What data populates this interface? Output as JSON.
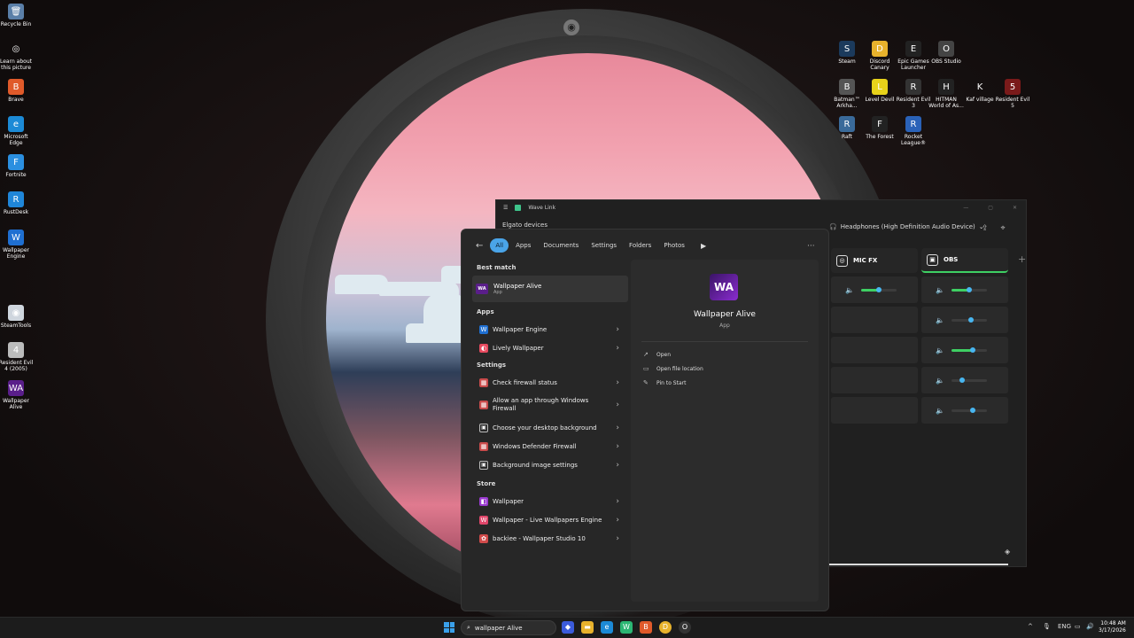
{
  "desktop_left": [
    {
      "label": "Recycle Bin",
      "icon": "recycle-bin-icon",
      "glyph": "🗑",
      "color": "#5a7fa8"
    },
    {
      "label": "Learn about this picture",
      "icon": "info-camera-icon",
      "glyph": "◎",
      "color": "transparent"
    },
    {
      "label": "Brave",
      "icon": "brave-icon",
      "glyph": "B",
      "color": "#e05a2a"
    },
    {
      "label": "Microsoft Edge",
      "icon": "edge-icon",
      "glyph": "e",
      "color": "#1c8ad6"
    },
    {
      "label": "Fortnite",
      "icon": "fortnite-icon",
      "glyph": "F",
      "color": "#2b8fe0"
    },
    {
      "label": "RustDesk",
      "icon": "rustdesk-icon",
      "glyph": "R",
      "color": "#1f86d9"
    },
    {
      "label": "Wallpaper Engine",
      "icon": "wallpaper-engine-icon",
      "glyph": "W",
      "color": "#1f6fd1"
    },
    {
      "label": "SteamTools",
      "icon": "steamtools-icon",
      "glyph": "◉",
      "color": "#cfd6de"
    },
    {
      "label": "Resident Evil 4 (2005)",
      "icon": "resident-evil-4-icon",
      "glyph": "4",
      "color": "#bbb"
    },
    {
      "label": "Wallpaper Alive",
      "icon": "wallpaper-alive-icon",
      "glyph": "WA",
      "color": "#5a1e8a"
    }
  ],
  "desktop_right": [
    {
      "label": "Steam",
      "icon": "steam-icon",
      "glyph": "S",
      "color": "#1b3a5c"
    },
    {
      "label": "Discord Canary",
      "icon": "discord-canary-icon",
      "glyph": "D",
      "color": "#e8b22c"
    },
    {
      "label": "Epic Games Launcher",
      "icon": "epic-games-icon",
      "glyph": "E",
      "color": "#222"
    },
    {
      "label": "OBS Studio",
      "icon": "obs-icon",
      "glyph": "O",
      "color": "#444"
    },
    {
      "label": "Batman™ Arkha...",
      "icon": "batman-icon",
      "glyph": "B",
      "color": "#555"
    },
    {
      "label": "Level Devil",
      "icon": "level-devil-icon",
      "glyph": "L",
      "color": "#e8d21a"
    },
    {
      "label": "Resident Evil 3",
      "icon": "resident-evil-3-icon",
      "glyph": "R",
      "color": "#333"
    },
    {
      "label": "HITMAN World of As...",
      "icon": "hitman-icon",
      "glyph": "H",
      "color": "#222"
    },
    {
      "label": "Kaf village",
      "icon": "kaf-village-icon",
      "glyph": "K",
      "color": "transparent"
    },
    {
      "label": "Resident Evil 5",
      "icon": "resident-evil-5-icon",
      "glyph": "5",
      "color": "#7a1a1a"
    },
    {
      "label": "Raft",
      "icon": "raft-icon",
      "glyph": "R",
      "color": "#3a6a9a"
    },
    {
      "label": "The Forest",
      "icon": "the-forest-icon",
      "glyph": "F",
      "color": "#222"
    },
    {
      "label": "Rocket League®",
      "icon": "rocket-league-icon",
      "glyph": "R",
      "color": "#2a62b8"
    }
  ],
  "wave": {
    "title": "Wave Link",
    "elgato": "Elgato devices",
    "device": "Headphones (High Definition Audio Device)",
    "mixes": [
      {
        "label": "MIC FX"
      },
      {
        "label": "OBS"
      }
    ],
    "sliders_left": [
      0.5,
      null,
      null,
      null,
      null
    ],
    "sliders_right": [
      0.5,
      0.55,
      0.6,
      0.3,
      0.6
    ]
  },
  "search": {
    "filters": [
      "All",
      "Apps",
      "Documents",
      "Settings",
      "Folders",
      "Photos"
    ],
    "best_match_header": "Best match",
    "best_match": {
      "title": "Wallpaper Alive",
      "subtitle": "App"
    },
    "apps_header": "Apps",
    "apps": [
      {
        "label": "Wallpaper Engine",
        "color": "#1f6fd1",
        "glyph": "W"
      },
      {
        "label": "Lively Wallpaper",
        "color": "#e84a5f",
        "glyph": "◐"
      }
    ],
    "settings_header": "Settings",
    "settings": [
      {
        "label": "Check firewall status",
        "color": "#c94b4b",
        "glyph": "▦"
      },
      {
        "label": "Allow an app through Windows Firewall",
        "color": "#c94b4b",
        "glyph": "▦"
      },
      {
        "label": "Choose your desktop background",
        "color": "transparent",
        "glyph": "▣"
      },
      {
        "label": "Windows Defender Firewall",
        "color": "#c94b4b",
        "glyph": "▦"
      },
      {
        "label": "Background image settings",
        "color": "transparent",
        "glyph": "▣"
      }
    ],
    "store_header": "Store",
    "store": [
      {
        "label": "Wallpaper",
        "color": "#9a3ad0",
        "glyph": "◧"
      },
      {
        "label": "Wallpaper - Live Wallpapers Engine",
        "color": "#e0466a",
        "glyph": "W"
      },
      {
        "label": "backiee - Wallpaper Studio 10",
        "color": "#d04a4a",
        "glyph": "✿"
      }
    ],
    "preview": {
      "logo": "WA",
      "name": "Wallpaper Alive",
      "type": "App",
      "actions": [
        "Open",
        "Open file location",
        "Pin to Start"
      ]
    }
  },
  "taskbar": {
    "search_text": "wallpaper Alive",
    "lang": "ENG",
    "time": "10:48 AM",
    "date": "3/17/2026"
  }
}
